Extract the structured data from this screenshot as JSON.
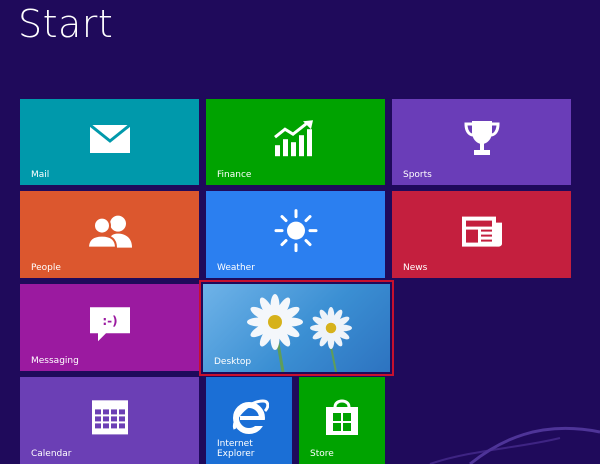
{
  "title": "Start",
  "tiles": [
    {
      "id": "mail",
      "label": "Mail",
      "color": "#0099ab",
      "icon": "mail-icon"
    },
    {
      "id": "finance",
      "label": "Finance",
      "color": "#00a300",
      "icon": "finance-chart-icon"
    },
    {
      "id": "sports",
      "label": "Sports",
      "color": "#6a3db8",
      "icon": "trophy-icon"
    },
    {
      "id": "people",
      "label": "People",
      "color": "#dc572e",
      "icon": "people-icon"
    },
    {
      "id": "weather",
      "label": "Weather",
      "color": "#2b7ff0",
      "icon": "sun-icon"
    },
    {
      "id": "news",
      "label": "News",
      "color": "#c41f3e",
      "icon": "newspaper-icon"
    },
    {
      "id": "messaging",
      "label": "Messaging",
      "color": "#9b1aa0",
      "icon": "chat-smiley-icon"
    },
    {
      "id": "desktop",
      "label": "Desktop",
      "color": "#3b8fd3",
      "icon": "daisy-wallpaper"
    },
    {
      "id": "calendar",
      "label": "Calendar",
      "color": "#6b3fb5",
      "icon": "calendar-icon"
    },
    {
      "id": "ie",
      "label": "Internet Explorer",
      "color": "#1b6fd6",
      "icon": "internet-explorer-icon"
    },
    {
      "id": "store",
      "label": "Store",
      "color": "#00a300",
      "icon": "store-bag-icon"
    }
  ],
  "selection_color": "#c8102e",
  "background_color": "#1f0a5b"
}
